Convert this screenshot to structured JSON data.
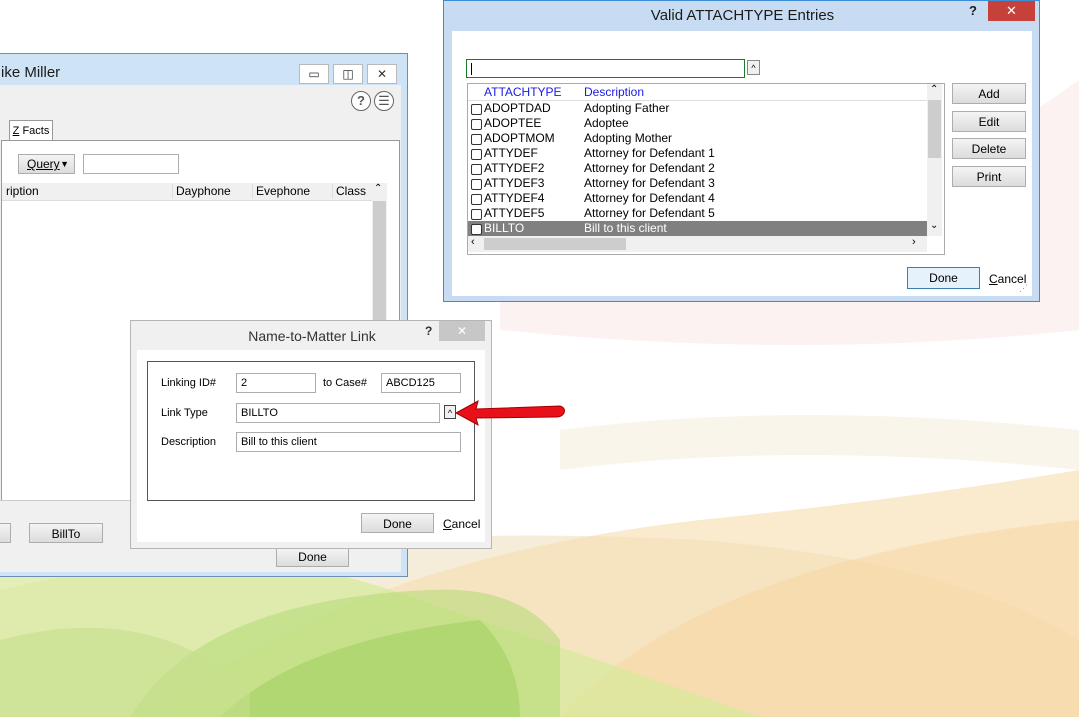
{
  "main_window": {
    "title": "ike Miller",
    "min": "▭",
    "max": "◫",
    "close": "✕",
    "tab_label_u": "Z",
    "tab_label_rest": " Facts",
    "query_label": "Query",
    "query_value": "",
    "columns": [
      "ription",
      "Dayphone",
      "Evephone",
      "Class"
    ],
    "billto_label": "BillTo",
    "done_label": "Done"
  },
  "attach_dialog": {
    "title": "Valid ATTACHTYPE Entries",
    "help": "?",
    "close": "✕",
    "search_value": "",
    "col_code": "ATTACHTYPE",
    "col_desc": "Description",
    "rows": [
      {
        "code": "ADOPTDAD",
        "desc": "Adopting Father"
      },
      {
        "code": "ADOPTEE",
        "desc": "Adoptee"
      },
      {
        "code": "ADOPTMOM",
        "desc": "Adopting Mother"
      },
      {
        "code": "ATTYDEF",
        "desc": "Attorney for Defendant 1"
      },
      {
        "code": "ATTYDEF2",
        "desc": "Attorney for Defendant 2"
      },
      {
        "code": "ATTYDEF3",
        "desc": "Attorney for Defendant 3"
      },
      {
        "code": "ATTYDEF4",
        "desc": "Attorney for Defendant 4"
      },
      {
        "code": "ATTYDEF5",
        "desc": "Attorney for Defendant 5"
      },
      {
        "code": "BILLTO",
        "desc": "Bill to this client"
      }
    ],
    "selected_row": 8,
    "add_label": "Add",
    "edit_label": "Edit",
    "delete_label": "Delete",
    "print_label": "Print",
    "done_label": "Done",
    "cancel_u": "C",
    "cancel_rest": "ancel"
  },
  "link_dialog": {
    "title": "Name-to-Matter Link",
    "help": "?",
    "close": "✕",
    "linking_label": "Linking  ID#",
    "linking_value": "2",
    "tocase_label": "to Case#",
    "tocase_value": "ABCD125",
    "linktype_label": "Link Type",
    "linktype_value": "BILLTO",
    "desc_label": "Description",
    "desc_value": "Bill to this client",
    "done_label": "Done",
    "cancel_u": "C",
    "cancel_rest": "ancel"
  },
  "colors": {
    "header_text": "#1a1ae6",
    "selected_row": "#808080",
    "close_button": "#e81123",
    "arrow": "#e8111a",
    "window_border": "#1e90ff"
  }
}
